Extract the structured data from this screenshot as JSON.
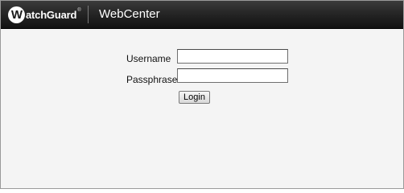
{
  "header": {
    "logo_initial": "W",
    "logo_text": "atchGuard",
    "logo_trademark": "®",
    "app_title": "WebCenter"
  },
  "login_form": {
    "username_label": "Username",
    "username_value": "",
    "passphrase_label": "Passphrase",
    "passphrase_value": "",
    "login_button": "Login"
  }
}
